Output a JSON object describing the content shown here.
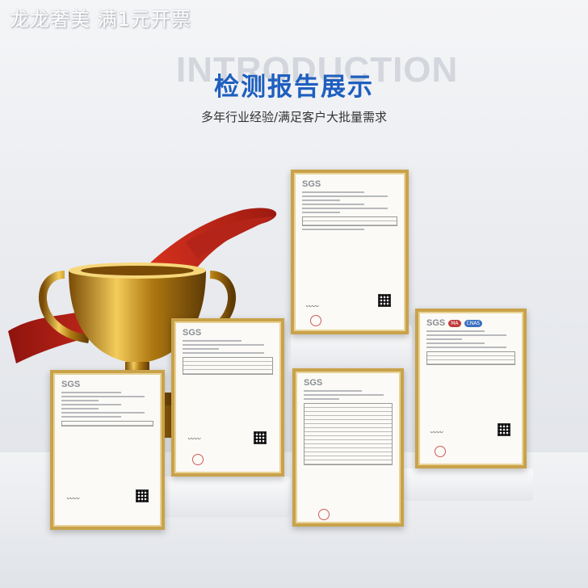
{
  "watermark": "龙龙奢美 满1元开票",
  "background_word": "INTRODUCTION",
  "title": "检测报告展示",
  "subtitle": "多年行业经验/满足客户大批量需求",
  "certificates": [
    {
      "logo": "SGS"
    },
    {
      "logo": "SGS"
    },
    {
      "logo": "SGS"
    },
    {
      "logo": "SGS"
    },
    {
      "logo": "SGS",
      "badges": [
        "MA",
        "CNAS"
      ]
    }
  ],
  "colors": {
    "title": "#1f5fbf",
    "frame": "#c9a24a",
    "ribbon": "#c0271c",
    "gold": "#d4a017"
  }
}
